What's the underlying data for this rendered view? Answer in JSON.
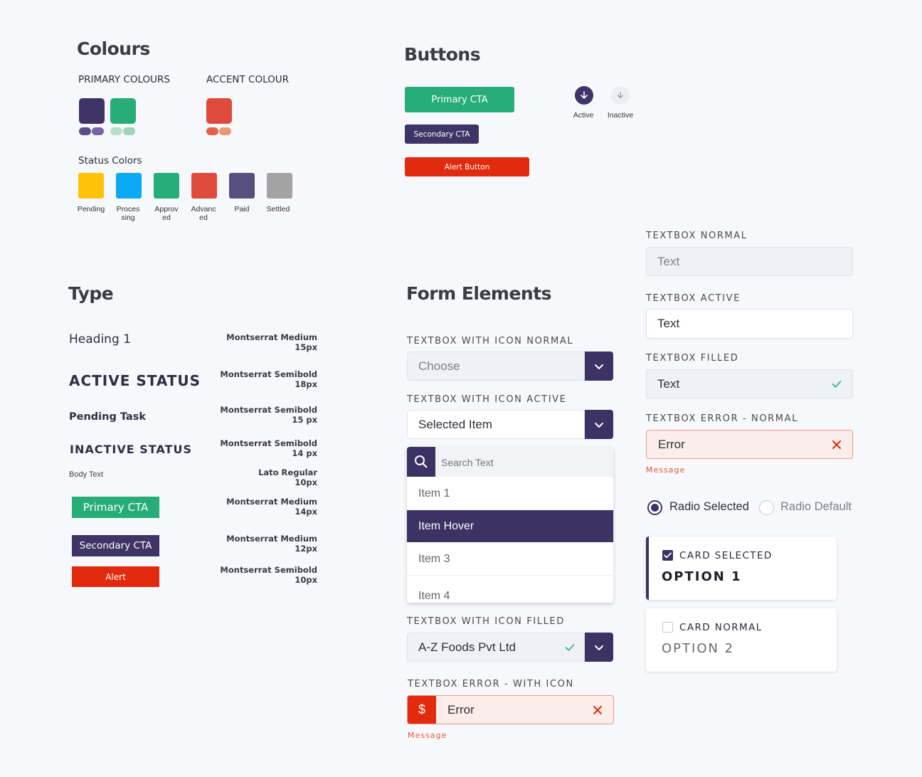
{
  "colours": {
    "title": "Colours",
    "primary_label": "PRIMARY COLOURS",
    "accent_label": "ACCENT COLOUR",
    "primary": [
      "#3e3466",
      "#27ad78"
    ],
    "primary_pills": [
      "#5b4f8a",
      "#7564a6",
      "#b9dfcc",
      "#9fd4b9"
    ],
    "accent": "#e04a3d",
    "accent_pills": [
      "#e6604c",
      "#ee947a"
    ],
    "status_title": "Status Colors",
    "status": [
      {
        "label": "Pending",
        "color": "#fec308"
      },
      {
        "label": "Proces sing",
        "color": "#09a9f4"
      },
      {
        "label": "Approv ed",
        "color": "#27ad78"
      },
      {
        "label": "Advanc ed",
        "color": "#e04a3d"
      },
      {
        "label": "Paid",
        "color": "#57507e"
      },
      {
        "label": "Settled",
        "color": "#a3a3a3"
      }
    ]
  },
  "buttons": {
    "title": "Buttons",
    "primary": "Primary CTA",
    "secondary": "Secondary CTA",
    "alert": "Alert Button",
    "active_label": "Active",
    "inactive_label": "Inactive"
  },
  "type": {
    "title": "Type",
    "samples": [
      {
        "text": "Heading 1",
        "spec1": "Montserrat Medium",
        "spec2": "15px"
      },
      {
        "text": "ACTIVE STATUS",
        "spec1": "Montserrat Semibold",
        "spec2": "18px"
      },
      {
        "text": "Pending Task",
        "spec1": "Montserrat Semibold",
        "spec2": "15 px"
      },
      {
        "text": "INACTIVE STATUS",
        "spec1": "Montserrat Semibold",
        "spec2": "14 px"
      },
      {
        "text": "Body Text",
        "spec1": "Lato Regular",
        "spec2": "10px"
      },
      {
        "text": "Primary CTA",
        "spec1": "Montserrat Medium",
        "spec2": "14px"
      },
      {
        "text": "Secondary CTA",
        "spec1": "Montserrat Medium",
        "spec2": "12px"
      },
      {
        "text": "Alert",
        "spec1": "Montserrat Semibold",
        "spec2": "10px"
      }
    ]
  },
  "form": {
    "title": "Form Elements",
    "icon_normal": {
      "label": "TEXTBOX WITH ICON NORMAL",
      "placeholder": "Choose"
    },
    "icon_active": {
      "label": "TEXTBOX WITH ICON ACTIVE",
      "value": "Selected Item"
    },
    "dropdown": {
      "search_placeholder": "Search Text",
      "items": [
        "Item 1",
        "Item Hover",
        "Item 3",
        "Item 4"
      ]
    },
    "icon_filled": {
      "label": "TEXTBOX WITH ICON FILLED",
      "value": "A-Z Foods Pvt Ltd"
    },
    "icon_error": {
      "label": "TEXTBOX ERROR - WITH ICON",
      "symbol": "$",
      "value": "Error",
      "message": "Message"
    }
  },
  "textboxes": {
    "normal": {
      "label": "TEXTBOX NORMAL",
      "placeholder": "Text"
    },
    "active": {
      "label": "TEXTBOX ACTIVE",
      "value": "Text"
    },
    "filled": {
      "label": "TEXTBOX FILLED",
      "value": "Text"
    },
    "error": {
      "label": "TEXTBOX ERROR - NORMAL",
      "value": "Error",
      "message": "Message"
    },
    "radio_selected": "Radio Selected",
    "radio_default": "Radio Default",
    "card_selected": {
      "label": "CARD SELECTED",
      "option": "OPTION 1"
    },
    "card_normal": {
      "label": "CARD NORMAL",
      "option": "OPTION 2"
    }
  }
}
